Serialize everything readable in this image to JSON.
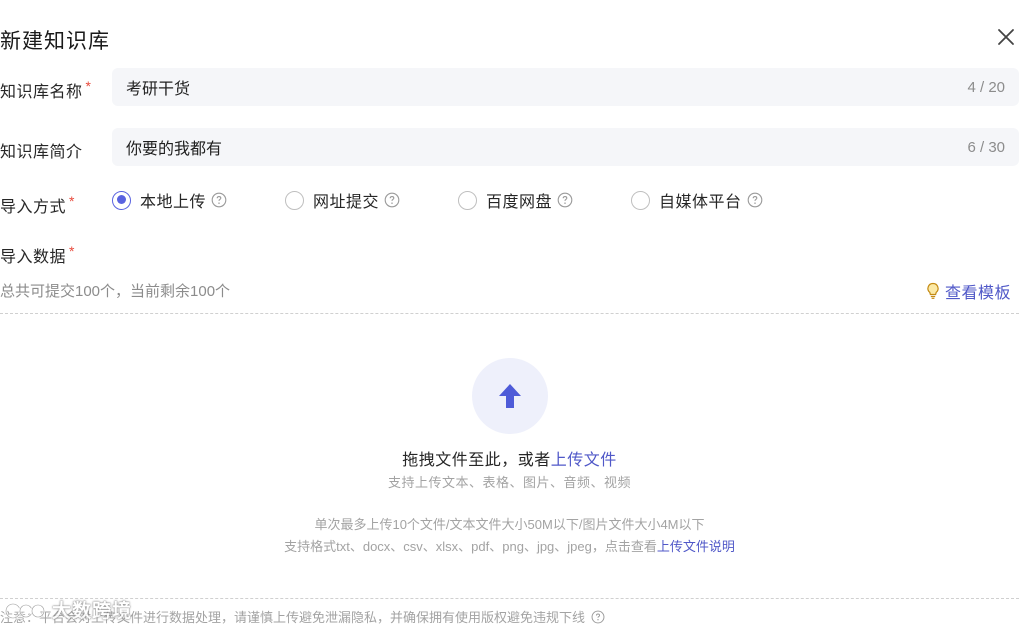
{
  "dialog": {
    "title": "新建知识库"
  },
  "form": {
    "name": {
      "label": "知识库名称",
      "required": "*",
      "value": "考研干货",
      "count": "4 / 20"
    },
    "intro": {
      "label": "知识库简介",
      "value": "你要的我都有",
      "count": "6 / 30"
    },
    "import_method": {
      "label": "导入方式",
      "required": "*",
      "options": [
        {
          "label": "本地上传",
          "checked": true
        },
        {
          "label": "网址提交",
          "checked": false
        },
        {
          "label": "百度网盘",
          "checked": false
        },
        {
          "label": "自媒体平台",
          "checked": false
        }
      ]
    },
    "import_data": {
      "label": "导入数据",
      "required": "*",
      "quota": "总共可提交100个，当前剩余100个",
      "template_link": "查看模板"
    }
  },
  "upload": {
    "drag_text": "拖拽文件至此，或者",
    "upload_link": "上传文件",
    "supported_types": "支持上传文本、表格、图片、音频、视频",
    "limit_text": "单次最多上传10个文件/文本文件大小50M以下/图片文件大小4M以下",
    "formats_text": "支持格式txt、docx、csv、xlsx、pdf、png、jpg、jpeg，点击查看",
    "formats_link": "上传文件说明"
  },
  "footer": {
    "note": "注意：平台会对上传文件进行数据处理，请谨慎上传避免泄漏隐私，并确保拥有使用版权避免违规下线"
  },
  "watermark": {
    "text": "大数跨境"
  },
  "colors": {
    "accent": "#5a63e0",
    "link": "#5058c8",
    "required": "#e8493b",
    "field_bg": "#f5f6f9",
    "muted_text": "#a3a3a3"
  },
  "icons": {
    "close": "close-icon",
    "help": "question-circle-icon",
    "bulb": "lightbulb-icon",
    "upload": "arrow-up-icon"
  }
}
